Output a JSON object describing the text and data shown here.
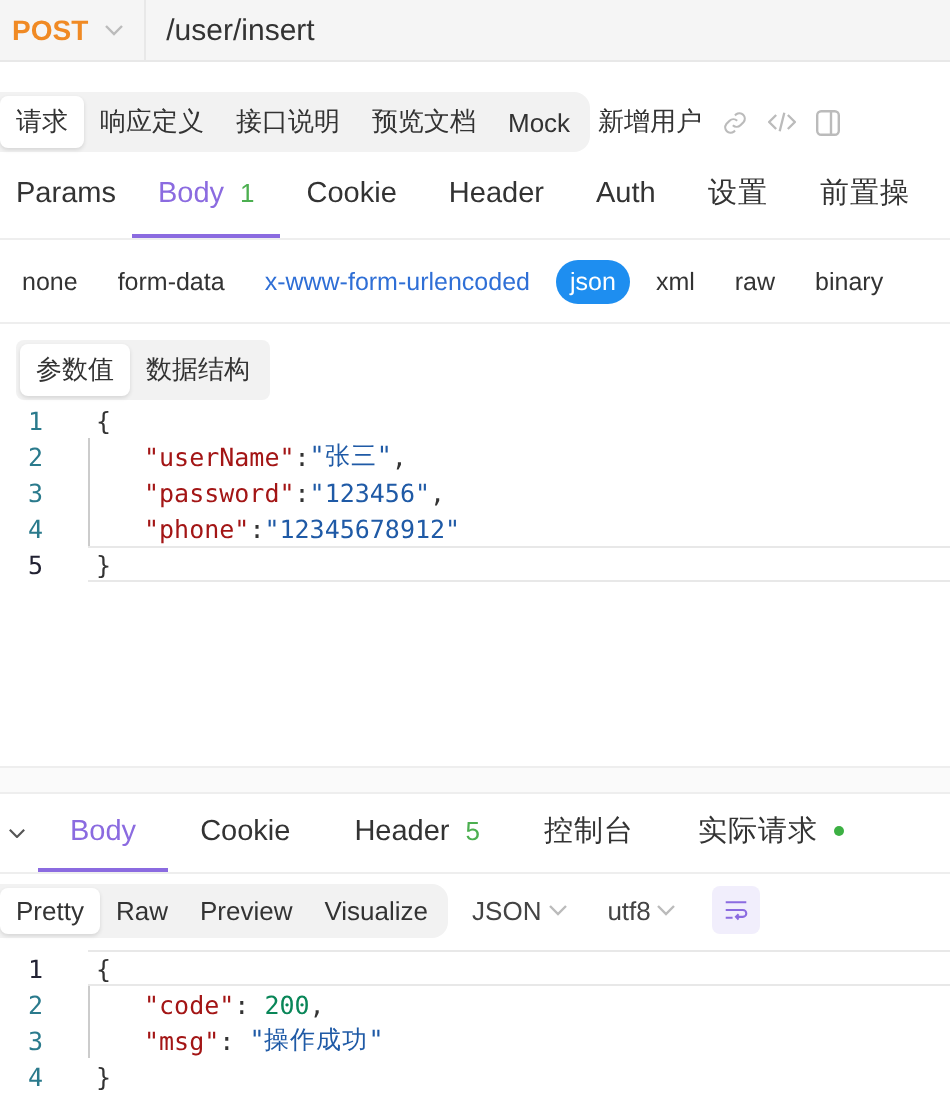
{
  "request": {
    "method": "POST",
    "url": "/user/insert"
  },
  "doc_tabs": [
    {
      "label": "请求",
      "selected": true
    },
    {
      "label": "响应定义",
      "selected": false
    },
    {
      "label": "接口说明",
      "selected": false
    },
    {
      "label": "预览文档",
      "selected": false
    },
    {
      "label": "Mock",
      "selected": false
    }
  ],
  "api_name": "新增用户",
  "request_tabs": [
    {
      "label": "Params",
      "selected": false
    },
    {
      "label": "Body",
      "count": "1",
      "selected": true
    },
    {
      "label": "Cookie",
      "selected": false
    },
    {
      "label": "Header",
      "selected": false
    },
    {
      "label": "Auth",
      "selected": false
    },
    {
      "label": "设置",
      "selected": false
    },
    {
      "label": "前置操",
      "selected": false
    }
  ],
  "body_types": [
    {
      "label": "none",
      "selected": false,
      "hovered": false
    },
    {
      "label": "form-data",
      "selected": false,
      "hovered": false
    },
    {
      "label": "x-www-form-urlencoded",
      "selected": false,
      "hovered": true
    },
    {
      "label": "json",
      "selected": true,
      "hovered": false
    },
    {
      "label": "xml",
      "selected": false,
      "hovered": false
    },
    {
      "label": "raw",
      "selected": false,
      "hovered": false
    },
    {
      "label": "binary",
      "selected": false,
      "hovered": false
    }
  ],
  "view_toggle": [
    {
      "label": "参数值",
      "selected": true
    },
    {
      "label": "数据结构",
      "selected": false
    }
  ],
  "request_body": [
    {
      "number": "1",
      "current": false,
      "indented": false,
      "tokens": [
        {
          "kind": "punct",
          "text": "{"
        }
      ]
    },
    {
      "number": "2",
      "current": false,
      "indented": true,
      "tokens": [
        {
          "kind": "key",
          "text": "\"userName\""
        },
        {
          "kind": "punct",
          "text": ":"
        },
        {
          "kind": "string",
          "text": "\"张三\""
        },
        {
          "kind": "punct",
          "text": ","
        }
      ]
    },
    {
      "number": "3",
      "current": false,
      "indented": true,
      "tokens": [
        {
          "kind": "key",
          "text": "\"password\""
        },
        {
          "kind": "punct",
          "text": ":"
        },
        {
          "kind": "string",
          "text": "\"123456\""
        },
        {
          "kind": "punct",
          "text": ","
        }
      ]
    },
    {
      "number": "4",
      "current": false,
      "indented": true,
      "tokens": [
        {
          "kind": "key",
          "text": "\"phone\""
        },
        {
          "kind": "punct",
          "text": ":"
        },
        {
          "kind": "string",
          "text": "\"12345678912\""
        }
      ]
    },
    {
      "number": "5",
      "current": true,
      "indented": false,
      "tokens": [
        {
          "kind": "punct",
          "text": "}"
        }
      ]
    }
  ],
  "response_tabs": [
    {
      "label": "Body",
      "selected": true
    },
    {
      "label": "Cookie",
      "selected": false
    },
    {
      "label": "Header",
      "count": "5",
      "selected": false
    },
    {
      "label": "控制台",
      "selected": false
    },
    {
      "label": "实际请求",
      "dot": true,
      "selected": false
    }
  ],
  "format_tabs": [
    {
      "label": "Pretty",
      "selected": true
    },
    {
      "label": "Raw",
      "selected": false
    },
    {
      "label": "Preview",
      "selected": false
    },
    {
      "label": "Visualize",
      "selected": false
    }
  ],
  "format": "JSON",
  "encoding": "utf8",
  "response_body": [
    {
      "number": "1",
      "current": true,
      "indented": false,
      "tokens": [
        {
          "kind": "punct",
          "text": "{"
        }
      ]
    },
    {
      "number": "2",
      "current": false,
      "indented": true,
      "tokens": [
        {
          "kind": "key",
          "text": "\"code\""
        },
        {
          "kind": "punct",
          "text": ": "
        },
        {
          "kind": "number",
          "text": "200"
        },
        {
          "kind": "punct",
          "text": ","
        }
      ]
    },
    {
      "number": "3",
      "current": false,
      "indented": true,
      "tokens": [
        {
          "kind": "key",
          "text": "\"msg\""
        },
        {
          "kind": "punct",
          "text": ": "
        },
        {
          "kind": "string",
          "text": "\"操作成功\""
        }
      ]
    },
    {
      "number": "4",
      "current": false,
      "indented": false,
      "tokens": [
        {
          "kind": "punct",
          "text": "}"
        }
      ]
    }
  ]
}
